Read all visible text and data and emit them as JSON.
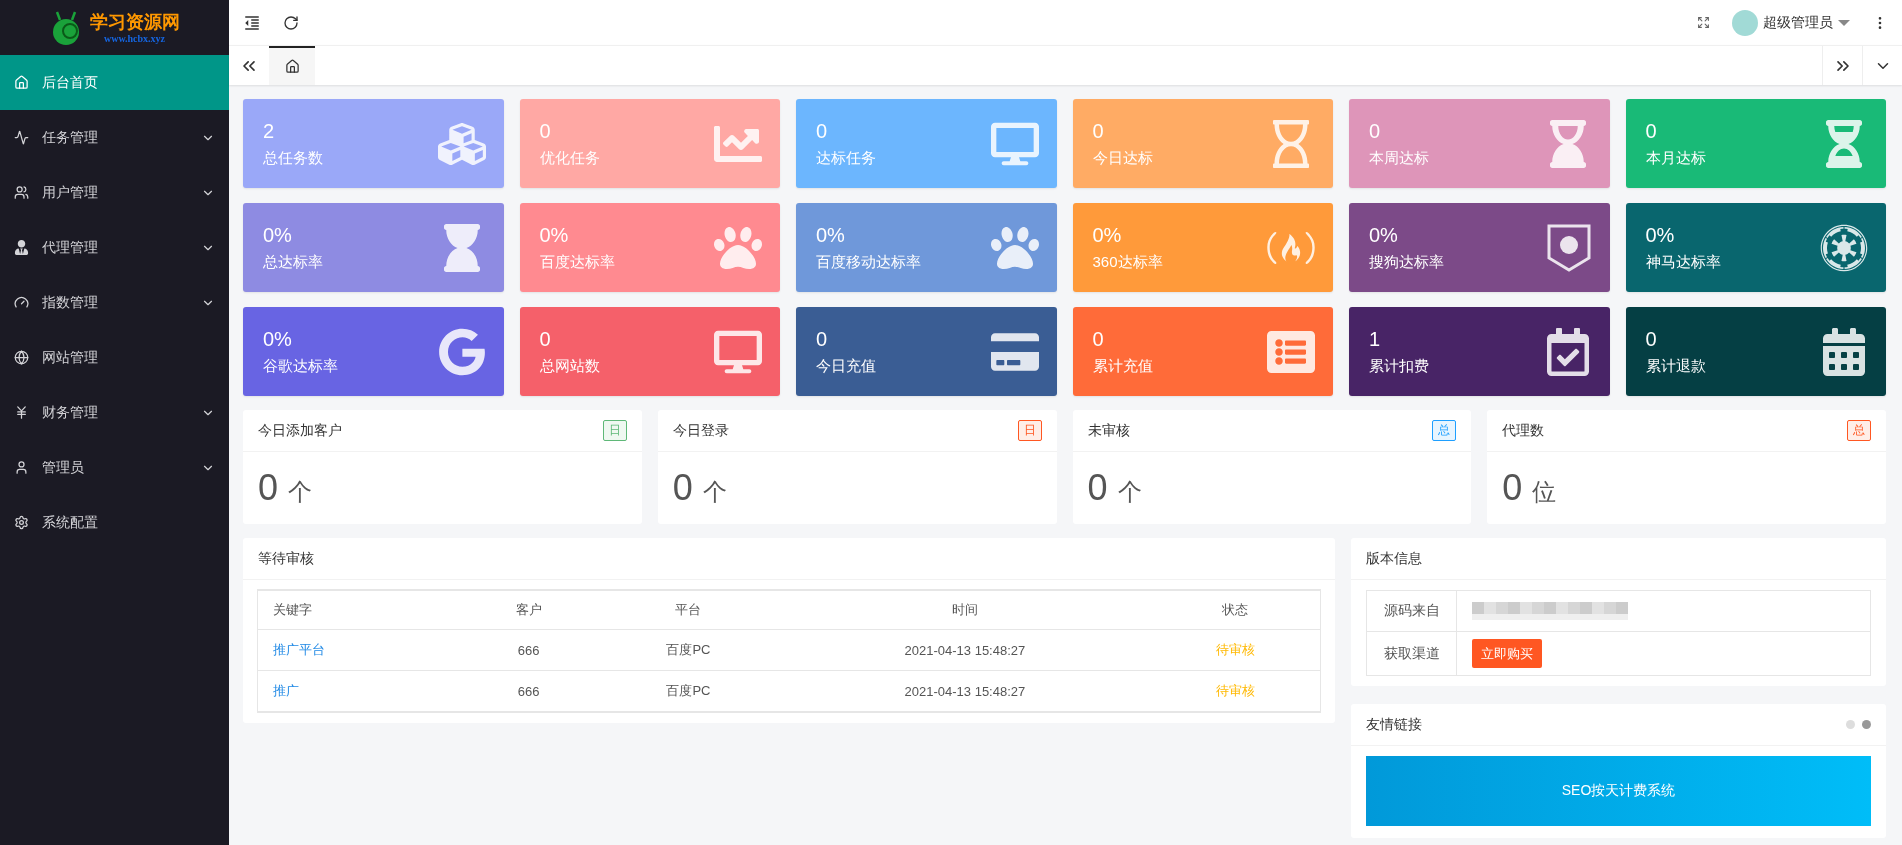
{
  "logo": {
    "title": "学习资源网",
    "subtitle": "www.hcbx.xyz"
  },
  "sidebar": {
    "items": [
      {
        "label": "后台首页",
        "selected": true,
        "expandable": false
      },
      {
        "label": "任务管理",
        "selected": false,
        "expandable": true
      },
      {
        "label": "用户管理",
        "selected": false,
        "expandable": true
      },
      {
        "label": "代理管理",
        "selected": false,
        "expandable": true
      },
      {
        "label": "指数管理",
        "selected": false,
        "expandable": true
      },
      {
        "label": "网站管理",
        "selected": false,
        "expandable": false
      },
      {
        "label": "财务管理",
        "selected": false,
        "expandable": true
      },
      {
        "label": "管理员",
        "selected": false,
        "expandable": true
      },
      {
        "label": "系统配置",
        "selected": false,
        "expandable": false
      }
    ]
  },
  "header": {
    "user": "超级管理员"
  },
  "tabs": [
    {
      "selected": true
    }
  ],
  "cards": [
    {
      "value": "2",
      "label": "总任务数",
      "color": "#9aa8f8"
    },
    {
      "value": "0",
      "label": "优化任务",
      "color": "#ffa8a4"
    },
    {
      "value": "0",
      "label": "达标任务",
      "color": "#6cb6fe"
    },
    {
      "value": "0",
      "label": "今日达标",
      "color": "#ffab64"
    },
    {
      "value": "0",
      "label": "本周达标",
      "color": "#de95b9"
    },
    {
      "value": "0",
      "label": "本月达标",
      "color": "#19ba77"
    },
    {
      "value": "0%",
      "label": "总达标率",
      "color": "#8e8be2"
    },
    {
      "value": "0%",
      "label": "百度达标率",
      "color": "#ff8a90"
    },
    {
      "value": "0%",
      "label": "百度移动达标率",
      "color": "#6f98da"
    },
    {
      "value": "0%",
      "label": "360达标率",
      "color": "#ff9a3a"
    },
    {
      "value": "0%",
      "label": "搜狗达标率",
      "color": "#7c4a88"
    },
    {
      "value": "0%",
      "label": "神马达标率",
      "color": "#09666e"
    },
    {
      "value": "0%",
      "label": "谷歌达标率",
      "color": "#6864e3"
    },
    {
      "value": "0",
      "label": "总网站数",
      "color": "#f5606a"
    },
    {
      "value": "0",
      "label": "今日充值",
      "color": "#3a5d94"
    },
    {
      "value": "0",
      "label": "累计充值",
      "color": "#ff6b39"
    },
    {
      "value": "1",
      "label": "累计扣费",
      "color": "#482466"
    },
    {
      "value": "0",
      "label": "累计退款",
      "color": "#053f44"
    }
  ],
  "stats": [
    {
      "title": "今日添加客户",
      "badge": "日",
      "color": "#5fb878",
      "value": "0",
      "unit": "个"
    },
    {
      "title": "今日登录",
      "badge": "日",
      "color": "#ff5722",
      "value": "0",
      "unit": "个"
    },
    {
      "title": "未审核",
      "badge": "总",
      "color": "#1e9fff",
      "value": "0",
      "unit": "个"
    },
    {
      "title": "代理数",
      "badge": "总",
      "color": "#ff5722",
      "value": "0",
      "unit": "位"
    }
  ],
  "pending": {
    "title": "等待审核",
    "columns": [
      "关键字",
      "客户",
      "平台",
      "时间",
      "状态"
    ],
    "rows": [
      [
        "推广平台",
        "666",
        "百度PC",
        "2021-04-13 15:48:27",
        "待审核"
      ],
      [
        "推广",
        "666",
        "百度PC",
        "2021-04-13 15:48:27",
        "待审核"
      ]
    ]
  },
  "version": {
    "title": "版本信息",
    "source_label": "源码来自",
    "channel_label": "获取渠道",
    "buy_button": "立即购买"
  },
  "links": {
    "title": "友情链接",
    "dots": [
      {
        "selected": false
      },
      {
        "selected": true
      }
    ],
    "banner": "SEO按天计费系统"
  }
}
